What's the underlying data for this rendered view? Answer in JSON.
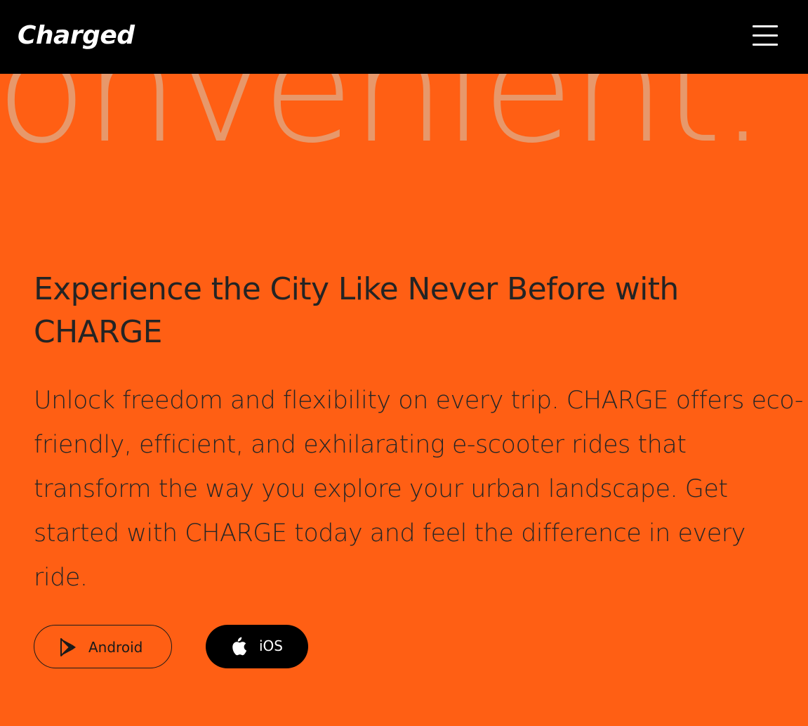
{
  "header": {
    "logo_text": "Charged",
    "menu_icon": "hamburger-menu-icon"
  },
  "hero": {
    "background_word": "onvenient.",
    "heading": "Experience the City Like Never Before with CHARGE",
    "description": "Unlock freedom and flexibility on every trip. CHARGE offers eco-friendly, efficient, and exhilarating e-scooter rides that transform the way you explore your urban landscape. Get started with CHARGE today and feel the difference in every ride.",
    "buttons": [
      {
        "label": "Android",
        "icon": "google-play-icon"
      },
      {
        "label": "iOS",
        "icon": "apple-icon"
      }
    ]
  },
  "colors": {
    "accent": "#ff5f14",
    "header_bg": "#000000",
    "background_word": "#e7986b",
    "text": "#242424"
  }
}
